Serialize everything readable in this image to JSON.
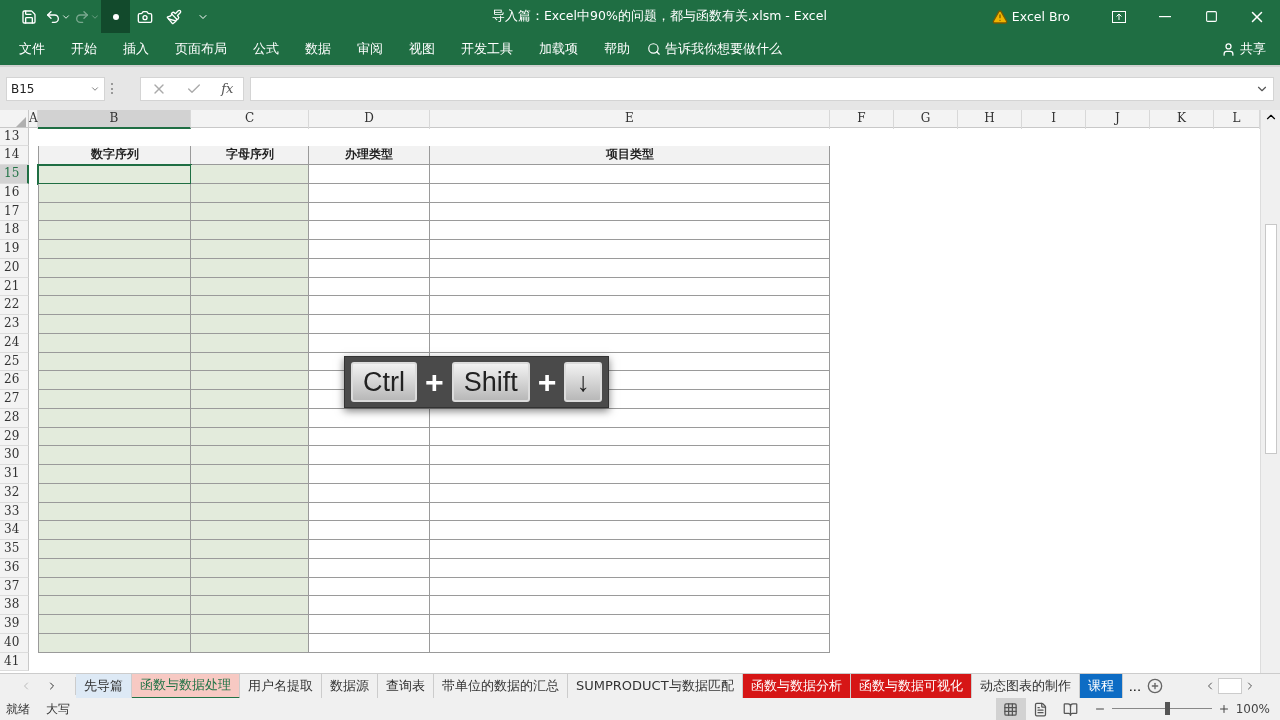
{
  "quick_access": [
    {
      "kind": "save"
    },
    {
      "kind": "undo"
    },
    {
      "kind": "redo",
      "disabled": true
    },
    {
      "kind": "dot"
    },
    {
      "kind": "camera"
    },
    {
      "kind": "brush"
    },
    {
      "kind": "more"
    }
  ],
  "window": {
    "title": "导入篇：Excel中90%的问题，都与函数有关.xlsm  -  Excel",
    "account": "Excel Bro"
  },
  "ribbon_tabs": [
    "文件",
    "开始",
    "插入",
    "页面布局",
    "公式",
    "数据",
    "审阅",
    "视图",
    "开发工具",
    "加载项",
    "帮助"
  ],
  "tell_me": "告诉我你想要做什么",
  "share": "共享",
  "formula_bar": {
    "name_box": "B15",
    "fx": "fx"
  },
  "columns": [
    {
      "letter": "A",
      "selected": false
    },
    {
      "letter": "B",
      "selected": true
    },
    {
      "letter": "C",
      "selected": false
    },
    {
      "letter": "D",
      "selected": false
    },
    {
      "letter": "E",
      "selected": false
    },
    {
      "letter": "F",
      "selected": false
    },
    {
      "letter": "G",
      "selected": false
    },
    {
      "letter": "H",
      "selected": false
    },
    {
      "letter": "I",
      "selected": false
    },
    {
      "letter": "J",
      "selected": false
    },
    {
      "letter": "K",
      "selected": false
    },
    {
      "letter": "L",
      "selected": false
    }
  ],
  "rows": [
    {
      "number": "13",
      "selected": false
    },
    {
      "number": "14",
      "selected": false
    },
    {
      "number": "15",
      "selected": true
    },
    {
      "number": "16",
      "selected": false
    },
    {
      "number": "17",
      "selected": false
    },
    {
      "number": "18",
      "selected": false
    },
    {
      "number": "19",
      "selected": false
    },
    {
      "number": "20",
      "selected": false
    },
    {
      "number": "21",
      "selected": false
    },
    {
      "number": "22",
      "selected": false
    },
    {
      "number": "23",
      "selected": false
    },
    {
      "number": "24",
      "selected": false
    },
    {
      "number": "25",
      "selected": false
    },
    {
      "number": "26",
      "selected": false
    },
    {
      "number": "27",
      "selected": false
    },
    {
      "number": "28",
      "selected": false
    },
    {
      "number": "29",
      "selected": false
    },
    {
      "number": "30",
      "selected": false
    },
    {
      "number": "31",
      "selected": false
    },
    {
      "number": "32",
      "selected": false
    },
    {
      "number": "33",
      "selected": false
    },
    {
      "number": "34",
      "selected": false
    },
    {
      "number": "35",
      "selected": false
    },
    {
      "number": "36",
      "selected": false
    },
    {
      "number": "37",
      "selected": false
    },
    {
      "number": "38",
      "selected": false
    },
    {
      "number": "39",
      "selected": false
    },
    {
      "number": "40",
      "selected": false
    },
    {
      "number": "41",
      "selected": false
    }
  ],
  "table": {
    "columns": [
      {
        "header": "数字序列",
        "shaded": true
      },
      {
        "header": "字母序列",
        "shaded": true
      },
      {
        "header": "办理类型",
        "shaded": false
      },
      {
        "header": "项目类型",
        "shaded": false
      }
    ]
  },
  "shortcut_overlay": [
    {
      "kind": "key",
      "label": "Ctrl"
    },
    {
      "kind": "plus",
      "label": "+"
    },
    {
      "kind": "key",
      "label": "Shift"
    },
    {
      "kind": "plus",
      "label": "+"
    },
    {
      "kind": "key",
      "label": "↓"
    }
  ],
  "sheet_tabs": [
    {
      "label": "先导篇",
      "selected": false,
      "color": "#dde9f5"
    },
    {
      "label": "函数与数据处理",
      "selected": true,
      "color": "#f7c9c3"
    },
    {
      "label": "用户名提取",
      "selected": false
    },
    {
      "label": "数据源",
      "selected": false
    },
    {
      "label": "查询表",
      "selected": false
    },
    {
      "label": "带单位的数据的汇总",
      "selected": false
    },
    {
      "label": "SUMPRODUCT与数据匹配",
      "selected": false
    },
    {
      "label": "函数与数据分析",
      "selected": false,
      "color": "#d61616"
    },
    {
      "label": "函数与数据可视化",
      "selected": false,
      "color": "#d61616"
    },
    {
      "label": "动态图表的制作",
      "selected": false
    },
    {
      "label": "课程",
      "selected": false,
      "color": "#0d6cc4"
    }
  ],
  "sheet_tabs_more": "...",
  "status_bar": {
    "items": [
      "就绪",
      "大写"
    ],
    "zoom": {
      "level": 0.55,
      "reading": "100%"
    }
  }
}
